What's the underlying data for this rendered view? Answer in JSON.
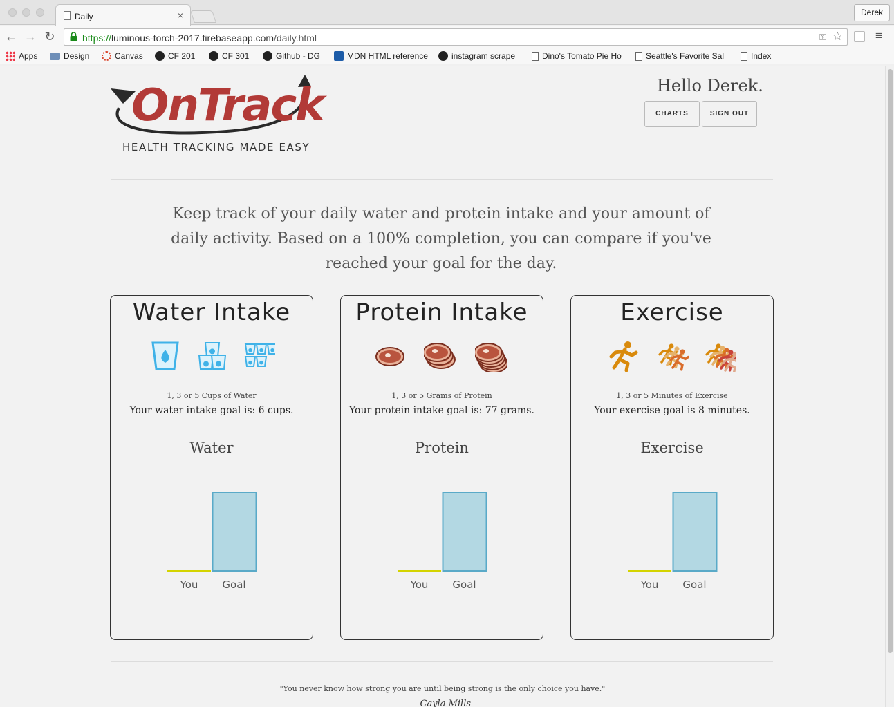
{
  "browser": {
    "tab_title": "Daily",
    "tab_close": "×",
    "profile_name": "Derek",
    "url_scheme": "https://",
    "url_host": "luminous-torch-2017.firebaseapp.com",
    "url_path": "/daily.html",
    "back": "←",
    "forward": "→",
    "reload": "↻",
    "star": "☆",
    "key": "⚿",
    "menu": "≡",
    "bookmarks": [
      {
        "label": "Apps",
        "icon": "apps-grid-icon"
      },
      {
        "label": "Design",
        "icon": "folder-icon"
      },
      {
        "label": "Canvas",
        "icon": "canvas-icon"
      },
      {
        "label": "CF 201",
        "icon": "github-icon"
      },
      {
        "label": "CF 301",
        "icon": "github-icon"
      },
      {
        "label": "Github - DG",
        "icon": "github-icon"
      },
      {
        "label": "MDN HTML reference",
        "icon": "mdn-icon"
      },
      {
        "label": "instagram scrape",
        "icon": "github-icon"
      },
      {
        "label": "Dino's Tomato Pie Ho",
        "icon": "page-icon"
      },
      {
        "label": "Seattle's Favorite Sal",
        "icon": "page-icon"
      },
      {
        "label": "Index",
        "icon": "page-icon"
      }
    ]
  },
  "header": {
    "logo_text": "OnTrack",
    "tagline": "HEALTH TRACKING MADE EASY",
    "greeting": "Hello Derek.",
    "charts_label": "CHARTS",
    "signout_label": "SIGN OUT"
  },
  "intro": "Keep track of your daily water and protein intake and your amount of daily activity. Based on a 100% completion, you can compare if you've reached your goal for the day.",
  "cards": [
    {
      "title": "Water Intake",
      "icons": [
        "water-cup-1-icon",
        "water-cups-3-icon",
        "water-cups-5-icon"
      ],
      "subtitle": "1, 3 or 5 Cups of Water",
      "goal_text": "Your water intake goal is: 6 cups.",
      "chart_title": "Water"
    },
    {
      "title": "Protein Intake",
      "icons": [
        "steak-1-icon",
        "steak-3-icon",
        "steak-5-icon"
      ],
      "subtitle": "1, 3 or 5 Grams of Protein",
      "goal_text": "Your protein intake goal is: 77 grams.",
      "chart_title": "Protein"
    },
    {
      "title": "Exercise",
      "icons": [
        "runner-1-icon",
        "runner-3-icon",
        "runner-5-icon"
      ],
      "subtitle": "1, 3 or 5 Minutes of Exercise",
      "goal_text": "Your exercise goal is 8 minutes.",
      "chart_title": "Exercise"
    }
  ],
  "chart_data": [
    {
      "type": "bar",
      "categories": [
        "You",
        "Goal"
      ],
      "values": [
        0,
        100
      ],
      "title": "Water",
      "ylim": [
        0,
        100
      ],
      "colors": [
        "#d4d400",
        "#b3d8e3"
      ],
      "border": "#5aaac8"
    },
    {
      "type": "bar",
      "categories": [
        "You",
        "Goal"
      ],
      "values": [
        0,
        100
      ],
      "title": "Protein",
      "ylim": [
        0,
        100
      ],
      "colors": [
        "#d4d400",
        "#b3d8e3"
      ],
      "border": "#5aaac8"
    },
    {
      "type": "bar",
      "categories": [
        "You",
        "Goal"
      ],
      "values": [
        0,
        100
      ],
      "title": "Exercise",
      "ylim": [
        0,
        100
      ],
      "colors": [
        "#d4d400",
        "#b3d8e3"
      ],
      "border": "#5aaac8"
    }
  ],
  "footer": {
    "quote": "\"You never know how strong you are until being strong is the only choice you have.\"",
    "author": "- Cayla Mills"
  },
  "colors": {
    "brand_red": "#b23a37",
    "water_blue": "#3fb2e8",
    "steak_brown": "#b9543e",
    "runner_orange": "#d98a0c"
  }
}
